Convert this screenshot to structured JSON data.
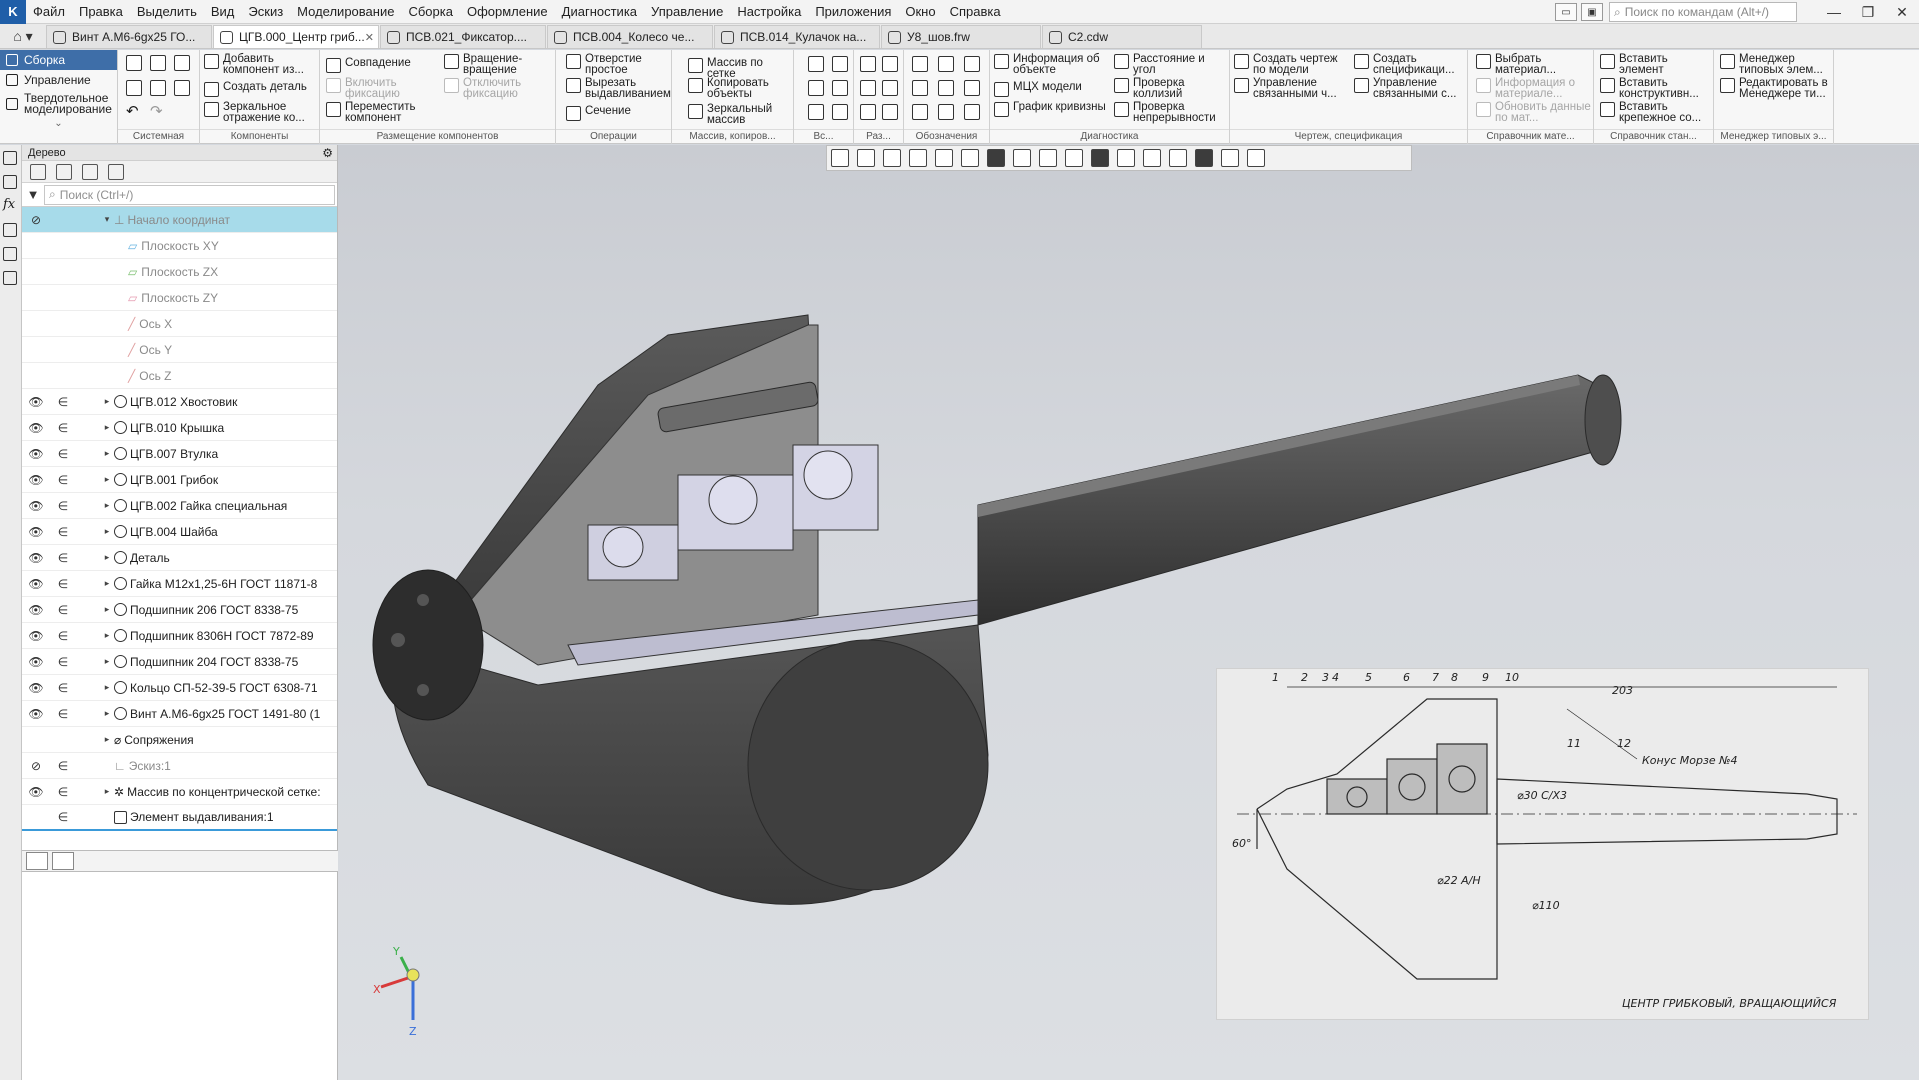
{
  "menu": {
    "items": [
      "Файл",
      "Правка",
      "Выделить",
      "Вид",
      "Эскиз",
      "Моделирование",
      "Сборка",
      "Оформление",
      "Диагностика",
      "Управление",
      "Настройка",
      "Приложения",
      "Окно",
      "Справка"
    ],
    "search_placeholder": "Поиск по командам (Alt+/)"
  },
  "tabs": [
    {
      "label": "Винт А.М6-6gx25 ГО...",
      "active": false
    },
    {
      "label": "ЦГВ.000_Центр гриб...",
      "active": true
    },
    {
      "label": "ПСВ.021_Фиксатор....",
      "active": false
    },
    {
      "label": "ПСВ.004_Колесо че...",
      "active": false
    },
    {
      "label": "ПСВ.014_Кулачок на...",
      "active": false
    },
    {
      "label": "У8_шов.frw",
      "active": false
    },
    {
      "label": "С2.cdw",
      "active": false
    }
  ],
  "modes": [
    {
      "label": "Сборка",
      "active": true
    },
    {
      "label": "Управление",
      "active": false
    },
    {
      "label": "Твердотельное моделирование",
      "active": false
    }
  ],
  "ribbon": {
    "groups": {
      "system": "Системная",
      "components": "Компоненты",
      "placement": "Размещение компонентов",
      "operations": "Операции",
      "array": "Массив, копиров...",
      "aux": "Вс...",
      "size": "Раз...",
      "notation": "Обозначения",
      "diagnostics": "Диагностика",
      "drawing": "Чертеж, спецификация",
      "materials": "Справочник мате...",
      "standard": "Справочник стан...",
      "typical": "Менеджер типовых э..."
    },
    "buttons": {
      "add_component": "Добавить компонент из...",
      "create_part": "Создать деталь",
      "mirror": "Зеркальное отражение ко...",
      "coincidence": "Совпадение",
      "rotate": "Вращение-вращение",
      "enable_fix": "Включить фиксацию",
      "disable_fix": "Отключить фиксацию",
      "move_component": "Переместить компонент",
      "hole": "Отверстие простое",
      "cut_extrude": "Вырезать выдавливанием",
      "section": "Сечение",
      "grid_array": "Массив по сетке",
      "copy_objects": "Копировать объекты",
      "mirror_array": "Зеркальный массив",
      "object_info": "Информация об объекте",
      "mass_props": "МЦХ модели",
      "curvature": "График кривизны",
      "distance": "Расстояние и угол",
      "collisions": "Проверка коллизий",
      "continuity": "Проверка непрерывности",
      "create_drawing": "Создать чертеж по модели",
      "linked_manage": "Управление связанными ч...",
      "create_spec": "Создать спецификаци...",
      "spec_manage": "Управление связанными с...",
      "choose_material": "Выбрать материал...",
      "material_info": "Информация о материале...",
      "update_data": "Обновить данные по мат...",
      "insert_element": "Вставить элемент",
      "insert_constr": "Вставить конструктивн...",
      "insert_fastener": "Вставить крепежное со...",
      "typical_manager": "Менеджер типовых элем...",
      "edit_in_manager": "Редактировать в Менеджере ти..."
    }
  },
  "tree": {
    "title": "Дерево",
    "search_placeholder": "Поиск (Ctrl+/)",
    "rows": [
      {
        "label": "Начало координат",
        "dim": true,
        "selected": true
      },
      {
        "label": "Плоскость XY",
        "dim": true
      },
      {
        "label": "Плоскость ZX",
        "dim": true
      },
      {
        "label": "Плоскость ZY",
        "dim": true
      },
      {
        "label": "Ось X",
        "dim": true
      },
      {
        "label": "Ось Y",
        "dim": true
      },
      {
        "label": "Ось Z",
        "dim": true
      },
      {
        "label": "ЦГВ.012 Хвостовик"
      },
      {
        "label": "ЦГВ.010 Крышка"
      },
      {
        "label": "ЦГВ.007 Втулка"
      },
      {
        "label": "ЦГВ.001 Грибок"
      },
      {
        "label": "ЦГВ.002 Гайка специальная"
      },
      {
        "label": "ЦГВ.004 Шайба"
      },
      {
        "label": "Деталь"
      },
      {
        "label": "Гайка М12х1,25-6Н ГОСТ 11871-8"
      },
      {
        "label": "Подшипник 206 ГОСТ 8338-75"
      },
      {
        "label": "Подшипник 8306Н ГОСТ 7872-89"
      },
      {
        "label": "Подшипник 204 ГОСТ 8338-75"
      },
      {
        "label": "Кольцо СП-52-39-5 ГОСТ 6308-71"
      },
      {
        "label": "Винт А.М6-6gx25 ГОСТ 1491-80 (1"
      },
      {
        "label": "Сопряжения"
      },
      {
        "label": "Эскиз:1",
        "dim": true
      },
      {
        "label": "Массив по концентрической сетке:"
      },
      {
        "label": "Элемент выдавливания:1"
      }
    ]
  },
  "triad": {
    "x": "X",
    "y": "Y",
    "z": "Z"
  },
  "drawing": {
    "callouts": [
      "1",
      "2",
      "3",
      "4",
      "5",
      "6",
      "7",
      "8",
      "9",
      "10",
      "11",
      "12"
    ],
    "dim_203": "203",
    "taper_label": "Конус Морзе №4",
    "angle_60": "60°",
    "dim_22": "⌀22 A/H",
    "dim_30": "⌀30 C/X3",
    "dim_110": "⌀110",
    "caption": "ЦЕНТР ГРИБКОВЫЙ, ВРАЩАЮЩИЙСЯ"
  }
}
